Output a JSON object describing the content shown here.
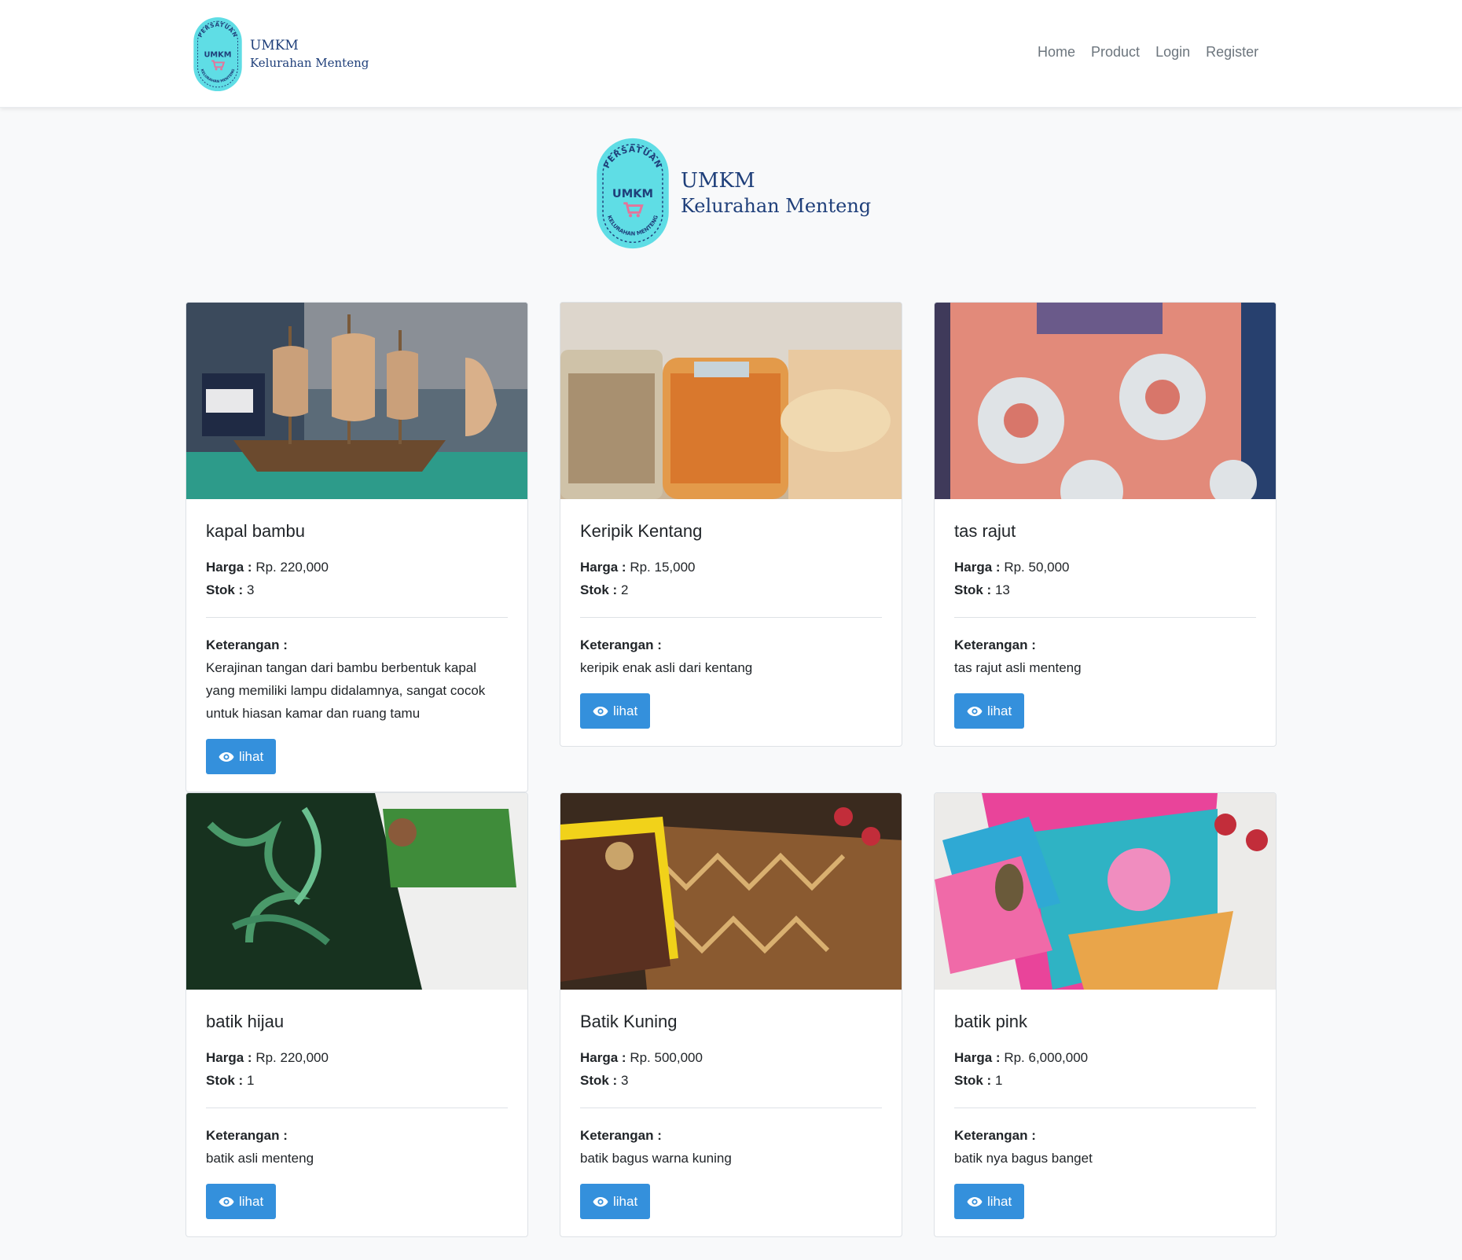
{
  "brand": {
    "badge_top": "PERSATUAN",
    "badge_center": "UMKM",
    "badge_bottom": "KELURAHAN MENTENG",
    "line1": "UMKM",
    "line2": "Kelurahan Menteng"
  },
  "nav": {
    "items": [
      {
        "label": "Home"
      },
      {
        "label": "Product"
      },
      {
        "label": "Login"
      },
      {
        "label": "Register"
      }
    ]
  },
  "labels": {
    "harga": "Harga :",
    "stok": "Stok :",
    "keterangan": "Keterangan :",
    "lihat": "lihat"
  },
  "products": [
    {
      "name": "kapal bambu",
      "price": "Rp. 220,000",
      "stock": "3",
      "description": "Kerajinan tangan dari bambu berbentuk kapal yang memiliki lampu didalamnya, sangat cocok untuk hiasan kamar dan ruang tamu",
      "image": "bamboo-ship-photo"
    },
    {
      "name": "Keripik Kentang",
      "price": "Rp. 15,000",
      "stock": "2",
      "description": "keripik enak asli dari kentang",
      "image": "potato-chips-photo"
    },
    {
      "name": "tas rajut",
      "price": "Rp. 50,000",
      "stock": "13",
      "description": "tas rajut asli menteng",
      "image": "crochet-bag-photo"
    },
    {
      "name": "batik hijau",
      "price": "Rp. 220,000",
      "stock": "1",
      "description": "batik asli menteng",
      "image": "green-batik-photo"
    },
    {
      "name": "Batik Kuning",
      "price": "Rp. 500,000",
      "stock": "3",
      "description": "batik bagus warna kuning",
      "image": "yellow-batik-photo"
    },
    {
      "name": "batik pink",
      "price": "Rp. 6,000,000",
      "stock": "1",
      "description": "batik nya bagus banget",
      "image": "pink-batik-photo"
    }
  ],
  "colors": {
    "primary_button": "#3490dc",
    "logo_teal": "#5fdde5",
    "logo_navy": "#1f3f7a",
    "cart_pink": "#e5739a",
    "page_bg": "#f8f9fa"
  }
}
